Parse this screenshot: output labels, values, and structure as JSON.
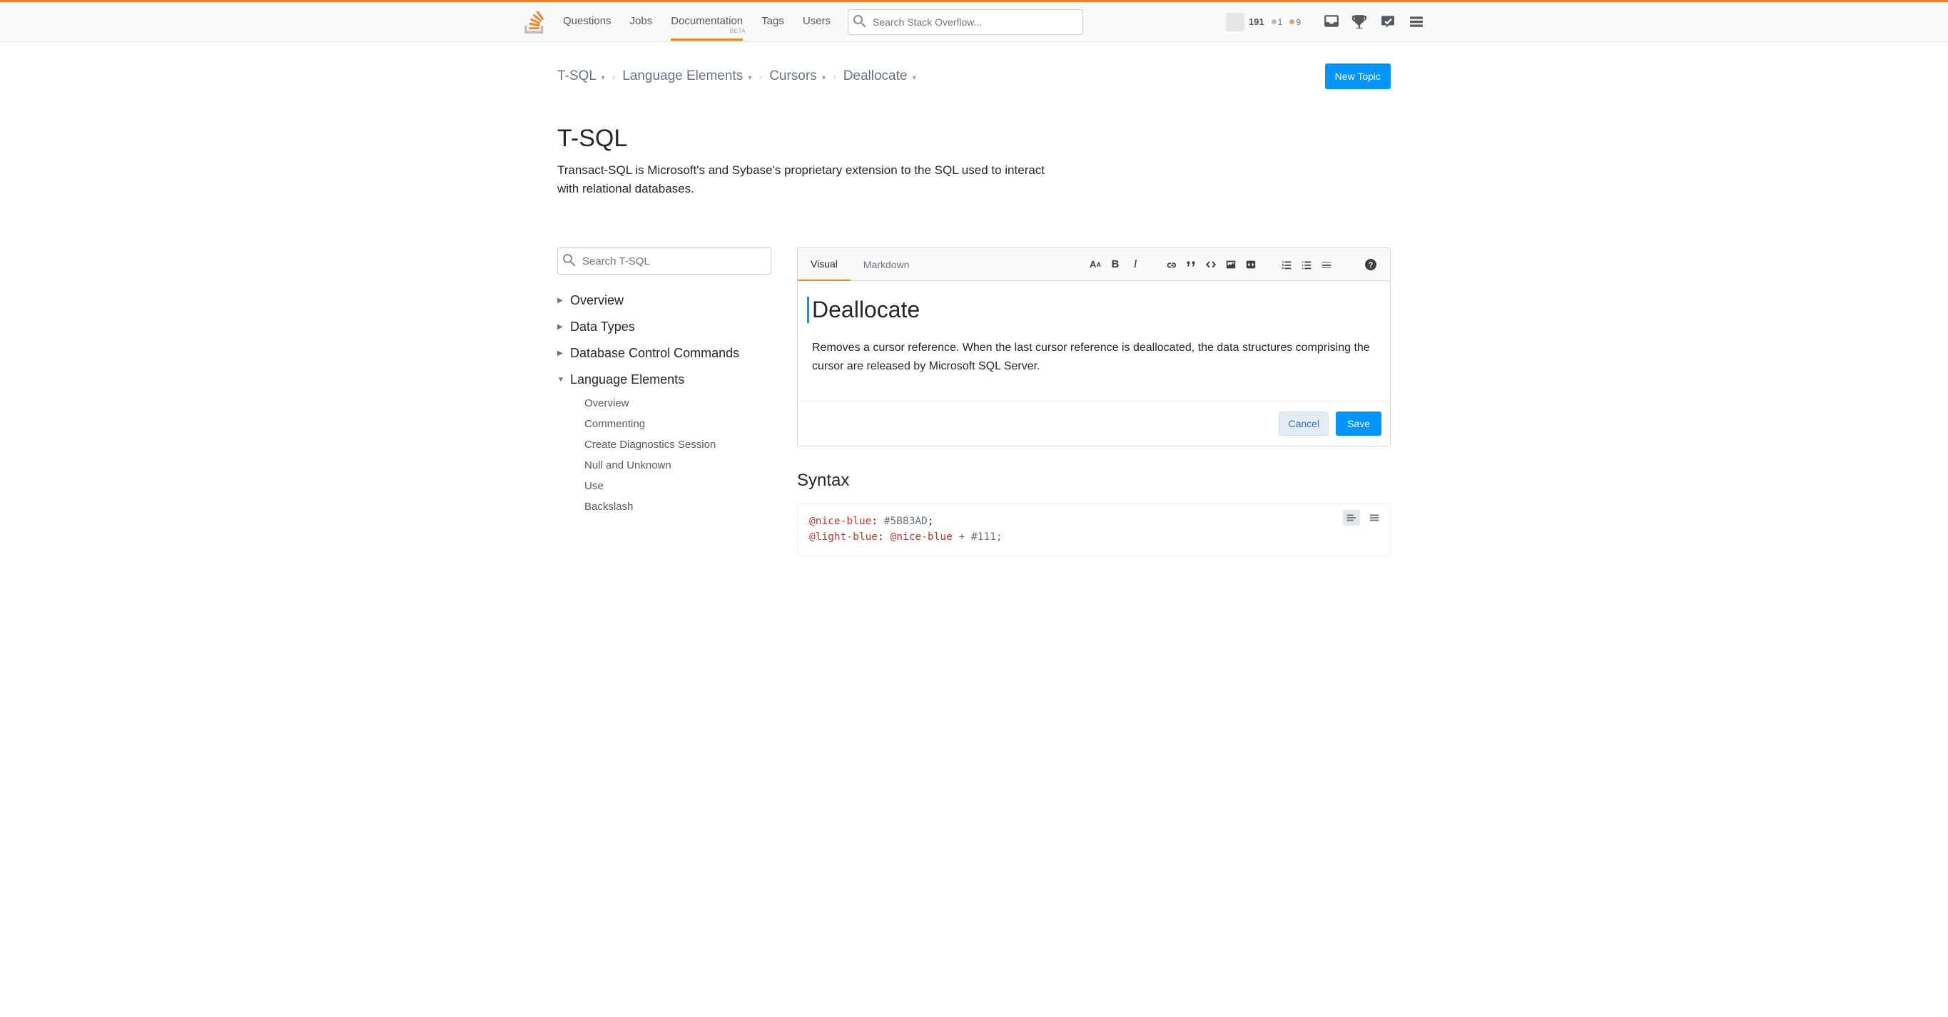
{
  "topnav": {
    "items": [
      "Questions",
      "Jobs",
      "Documentation",
      "Tags",
      "Users"
    ],
    "active_index": 2,
    "beta_label": "BETA",
    "search_placeholder": "Search Stack Overflow..."
  },
  "user": {
    "rep": "191",
    "silver": "1",
    "bronze": "9"
  },
  "breadcrumb": {
    "items": [
      "T-SQL",
      "Language Elements",
      "Cursors",
      "Deallocate"
    ],
    "new_topic": "New Topic"
  },
  "page": {
    "title": "T-SQL",
    "desc": "Transact-SQL is Microsoft's and Sybase's proprietary extension to the SQL used to interact with relational databases."
  },
  "sidebar": {
    "search_placeholder": "Search T-SQL",
    "tree": [
      {
        "label": "Overview",
        "expanded": false
      },
      {
        "label": "Data Types",
        "expanded": false
      },
      {
        "label": "Database Control Commands",
        "expanded": false
      },
      {
        "label": "Language Elements",
        "expanded": true,
        "children": [
          "Overview",
          "Commenting",
          "Create Diagnostics Session",
          "Null and Unknown",
          "Use",
          "Backslash"
        ]
      }
    ]
  },
  "editor": {
    "tabs": {
      "visual": "Visual",
      "markdown": "Markdown"
    },
    "title": "Deallocate",
    "body": "Removes a cursor reference. When the last cursor reference is deallocated, the data structures comprising the cursor are released by Microsoft SQL Server.",
    "cancel": "Cancel",
    "save": "Save"
  },
  "syntax": {
    "heading": "Syntax",
    "line1_var": "@nice-blue",
    "line1_sep": ": ",
    "line1_val": "#5B83AD",
    "line1_end": ";",
    "line2_var": "@light-blue",
    "line2_sep": ": ",
    "line2_ref": "@nice-blue",
    "line2_plus": " + #111;"
  }
}
